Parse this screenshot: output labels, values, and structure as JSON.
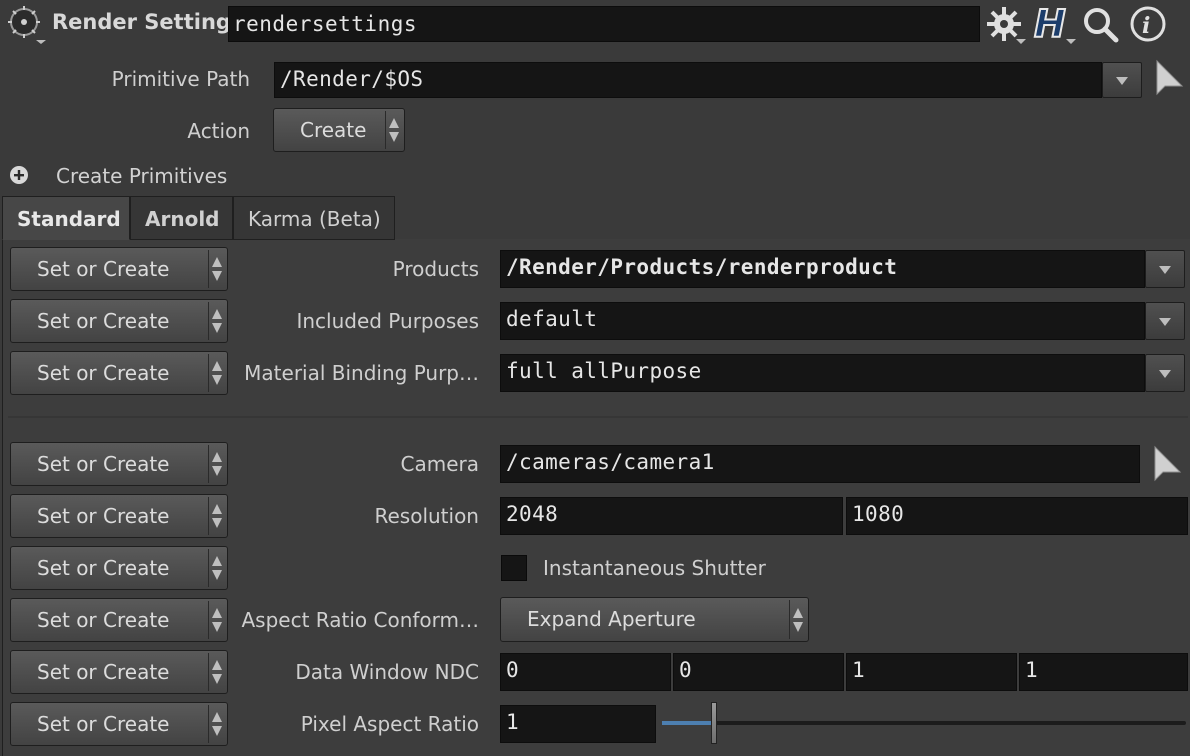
{
  "header": {
    "node_type": "Render Settings",
    "node_name": "rendersettings",
    "icons": [
      "render-node-icon",
      "gear-icon",
      "houdini-h-icon",
      "search-icon",
      "info-icon"
    ]
  },
  "primitive_path": {
    "label": "Primitive Path",
    "value": "/Render/$OS"
  },
  "action": {
    "label": "Action",
    "value": "Create"
  },
  "create_primitives": {
    "label": "Create Primitives"
  },
  "tabs": [
    {
      "label": "Standard",
      "active": true
    },
    {
      "label": "Arnold",
      "active": false
    },
    {
      "label": "Karma (Beta)",
      "active": false
    }
  ],
  "set_or_create_label": "Set or Create",
  "params": {
    "products": {
      "label": "Products",
      "value": "/Render/Products/renderproduct"
    },
    "included_purposes": {
      "label": "Included Purposes",
      "value": "default"
    },
    "material_binding": {
      "label": "Material Binding Purp…",
      "value": "full allPurpose"
    },
    "camera": {
      "label": "Camera",
      "value": "/cameras/camera1"
    },
    "resolution": {
      "label": "Resolution",
      "x": "2048",
      "y": "1080"
    },
    "instantaneous_shutter": {
      "label": "Instantaneous Shutter",
      "checked": false
    },
    "aspect_ratio": {
      "label": "Aspect Ratio Conform…",
      "value": "Expand Aperture"
    },
    "data_window": {
      "label": "Data Window NDC",
      "values": [
        "0",
        "0",
        "1",
        "1"
      ]
    },
    "pixel_aspect": {
      "label": "Pixel Aspect Ratio",
      "value": "1",
      "slider_fraction": 0.1
    }
  },
  "colors": {
    "background": "#3a3a3a",
    "field": "#151515",
    "slider_fill": "#4d7fb0"
  }
}
